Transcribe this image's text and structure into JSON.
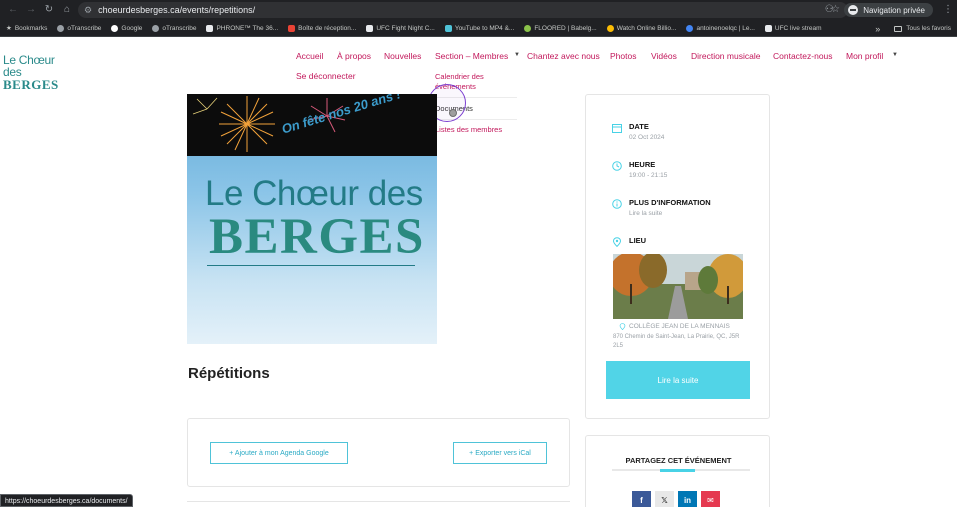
{
  "browser": {
    "url": "choeurdesberges.ca/events/repetitions/",
    "private_label": "Navigation privée",
    "bookmarks": [
      {
        "label": "Bookmarks",
        "color": "#c4c7c5"
      },
      {
        "label": "oTranscribe",
        "color": "#9aa0a6"
      },
      {
        "label": "Google",
        "color": "#ffffff"
      },
      {
        "label": "oTranscribe",
        "color": "#9aa0a6"
      },
      {
        "label": "PHRONE™ The 36...",
        "color": "#e8eaed"
      },
      {
        "label": "Boîte de réception...",
        "color": "#ea4335"
      },
      {
        "label": "UFC Fight Night C...",
        "color": "#e8eaed"
      },
      {
        "label": "YouTube to MP4 &...",
        "color": "#4fc3d8"
      },
      {
        "label": "FLOORED | Babelg...",
        "color": "#8bc34a"
      },
      {
        "label": "Watch Online Billio...",
        "color": "#fbbc04"
      },
      {
        "label": "antoinenoelqc | Le...",
        "color": "#4285f4"
      },
      {
        "label": "UFC live stream",
        "color": "#e8eaed"
      }
    ],
    "all_bookmarks": "Tous les favoris",
    "status_url": "https://choeurdesberges.ca/documents/"
  },
  "site": {
    "logo_line1": "Le Chœur des",
    "logo_line2": "BERGES"
  },
  "nav": {
    "items": [
      "Accueil",
      "À propos",
      "Nouvelles",
      "Section – Membres",
      "Chantez avec nous",
      "Photos",
      "Vidéos",
      "Direction musicale",
      "Contactez-nous",
      "Mon profil"
    ],
    "logout": "Se déconnecter"
  },
  "dropdown": {
    "items": [
      "Calendrier des",
      "événements",
      "Documents",
      "Listes des membres"
    ]
  },
  "hero": {
    "banner": "On fête nos 20 ans !",
    "line1": "Le Chœur des",
    "line2": "BERGES"
  },
  "event": {
    "title": "Répétitions",
    "google_button": "+ Ajouter à mon Agenda Google",
    "ical_button": "+ Exporter vers iCal"
  },
  "details": {
    "date_label": "DATE",
    "date_value": "02 Oct 2024",
    "time_label": "HEURE",
    "time_value": "19:00 - 21:15",
    "more_label": "PLUS D'INFORMATION",
    "more_value": "Lire la suite",
    "venue_label": "LIEU",
    "venue_name": "COLLÈGE JEAN DE LA MENNAIS",
    "venue_address": "870 Chemin de Saint-Jean, La Prairie, QC, J5R 2L5",
    "button": "Lire la suite",
    "accent": "#48d2e6"
  },
  "share": {
    "title": "PARTAGEZ CET ÉVÉNEMENT",
    "icons": [
      "facebook-icon",
      "x-icon",
      "linkedin-icon",
      "email-icon"
    ]
  }
}
